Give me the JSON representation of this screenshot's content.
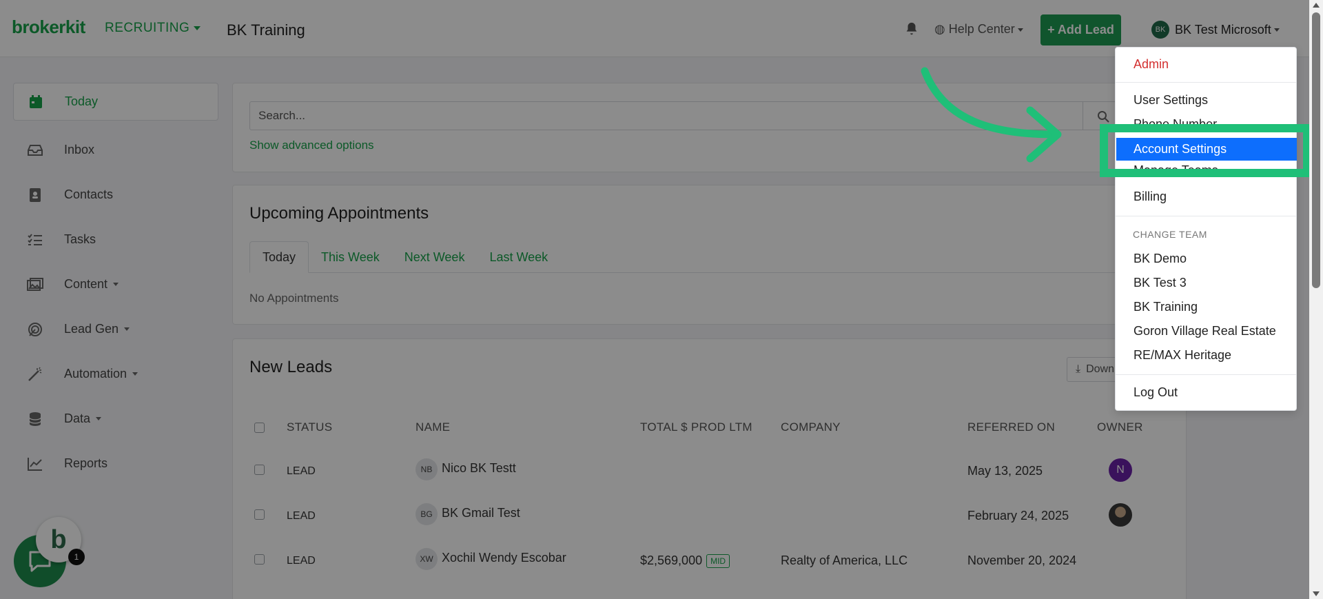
{
  "header": {
    "brand": "brokerkit",
    "product": "RECRUITING",
    "team": "BK Training",
    "help": "Help Center",
    "add_lead": "+ Add Lead",
    "user_initials": "BK",
    "user_name": "BK Test Microsoft"
  },
  "sidebar": {
    "items": [
      {
        "label": "Today",
        "icon": "calendar-icon"
      },
      {
        "label": "Inbox",
        "icon": "inbox-icon"
      },
      {
        "label": "Contacts",
        "icon": "contacts-icon"
      },
      {
        "label": "Tasks",
        "icon": "tasks-icon"
      },
      {
        "label": "Content",
        "icon": "image-icon"
      },
      {
        "label": "Lead Gen",
        "icon": "target-icon"
      },
      {
        "label": "Automation",
        "icon": "wand-icon"
      },
      {
        "label": "Data",
        "icon": "database-icon"
      },
      {
        "label": "Reports",
        "icon": "chart-icon"
      }
    ]
  },
  "search": {
    "placeholder": "Search...",
    "advanced": "Show advanced options"
  },
  "appointments": {
    "title": "Upcoming Appointments",
    "tabs": [
      "Today",
      "This Week",
      "Next Week",
      "Last Week"
    ],
    "empty": "No Appointments"
  },
  "leads": {
    "title": "New Leads",
    "download": "Down",
    "columns": [
      "STATUS",
      "NAME",
      "TOTAL $ PROD LTM",
      "COMPANY",
      "REFERRED ON",
      "OWNER"
    ],
    "rows": [
      {
        "status": "LEAD",
        "initials": "NB",
        "name": "Nico BK Testt",
        "prod": "",
        "tier": "",
        "company": "",
        "referred": "May 13, 2025",
        "owner": "N"
      },
      {
        "status": "LEAD",
        "initials": "BG",
        "name": "BK Gmail Test",
        "prod": "",
        "tier": "",
        "company": "",
        "referred": "February 24, 2025",
        "owner": ""
      },
      {
        "status": "LEAD",
        "initials": "XW",
        "name": "Xochil Wendy Escobar",
        "prod": "$2,569,000",
        "tier": "MID",
        "company": "Realty of America, LLC",
        "referred": "November 20, 2024",
        "owner": ""
      }
    ]
  },
  "menu": {
    "admin": "Admin",
    "user_settings": "User Settings",
    "phone_number": "Phone Number",
    "account_settings": "Account Settings",
    "manage_teams": "Manage Teams",
    "billing": "Billing",
    "change_team_header": "CHANGE TEAM",
    "teams": [
      "BK Demo",
      "BK Test 3",
      "BK Training",
      "Goron Village Real Estate",
      "RE/MAX Heritage"
    ],
    "logout": "Log Out"
  },
  "chat": {
    "badge": "1",
    "logo": "b"
  },
  "colors": {
    "brand": "#16a34a",
    "primary_button": "#1e9b52",
    "highlight": "#1fbf78",
    "active_menu": "#0d6efd",
    "admin": "#d32f2f"
  }
}
